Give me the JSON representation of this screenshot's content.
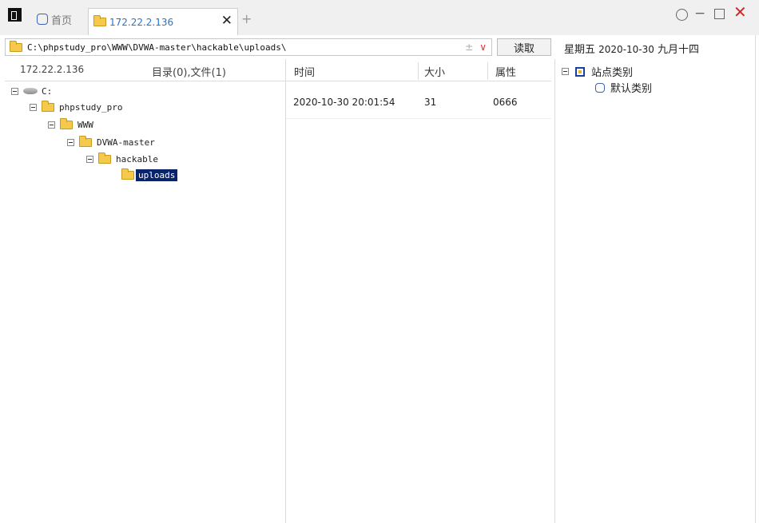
{
  "tabs": {
    "home_label": "首页",
    "active_label": "172.22.2.136",
    "close_glyph": "✕",
    "add_glyph": "+"
  },
  "window_controls": {
    "minimize_glyph": "−",
    "close_glyph": "✕",
    "close_color": "#e02020"
  },
  "address": {
    "path": "C:\\phpstudy_pro\\WWW\\DVWA-master\\hackable\\uploads\\",
    "plusminus_glyph": "±",
    "dropdown_glyph": "∨",
    "read_button": "读取"
  },
  "date_display": {
    "weekday": "星期五",
    "date": "2020-10-30",
    "lunar": "九月十四"
  },
  "left_header": {
    "host": "172.22.2.136",
    "count": "目录(0),文件(1)"
  },
  "file_columns": [
    "时间",
    "大小",
    "属性"
  ],
  "tree": [
    {
      "label": "C:",
      "type": "drive"
    },
    {
      "label": "phpstudy_pro",
      "type": "folder"
    },
    {
      "label": "WWW",
      "type": "folder"
    },
    {
      "label": "DVWA-master",
      "type": "folder"
    },
    {
      "label": "hackable",
      "type": "folder"
    },
    {
      "label": "uploads",
      "type": "folder-open",
      "selected": true
    }
  ],
  "files": [
    {
      "time": "2020-10-30 20:01:54",
      "size": "31",
      "attr": "0666"
    }
  ],
  "site_tree": {
    "root_label": "站点类别",
    "children": [
      "默认类别"
    ]
  },
  "colors": {
    "selection": "#0a246a",
    "tab_text": "#2a73c9",
    "folder": "#f5c94c"
  }
}
